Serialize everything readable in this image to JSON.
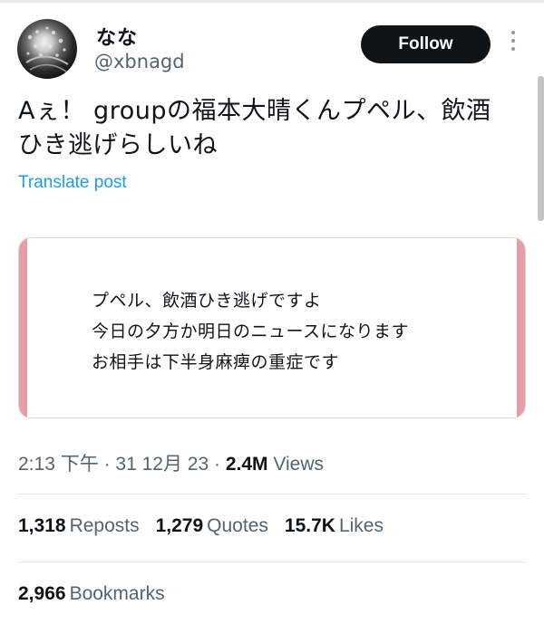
{
  "author": {
    "display_name": "なな",
    "handle": "@xbnagd",
    "avatar_icon": "dark-glitter-pattern-avatar"
  },
  "header": {
    "follow_label": "Follow",
    "more_icon": "vertical-ellipsis-icon"
  },
  "tweet": {
    "text_lines": [
      "Aぇ！ groupの福本大晴くんプペル、飲酒",
      "ひき逃げらしいね"
    ],
    "translate_label": "Translate post"
  },
  "quoted_image": {
    "lines": [
      "プペル、飲酒ひき逃げですよ",
      "今日の夕方か明日のニュースになります",
      "お相手は下半身麻痺の重症です"
    ],
    "border_accent": "#e79da6"
  },
  "meta": {
    "time": "2:13 下午",
    "date": "31 12月 23",
    "views_count": "2.4M",
    "views_label": "Views"
  },
  "stats": {
    "reposts_count": "1,318",
    "reposts_label": "Reposts",
    "quotes_count": "1,279",
    "quotes_label": "Quotes",
    "likes_count": "15.7K",
    "likes_label": "Likes",
    "bookmarks_count": "2,966",
    "bookmarks_label": "Bookmarks"
  },
  "colors": {
    "accent_link": "#1d9bf0",
    "text_primary": "#0f1419",
    "text_secondary": "#536471"
  }
}
